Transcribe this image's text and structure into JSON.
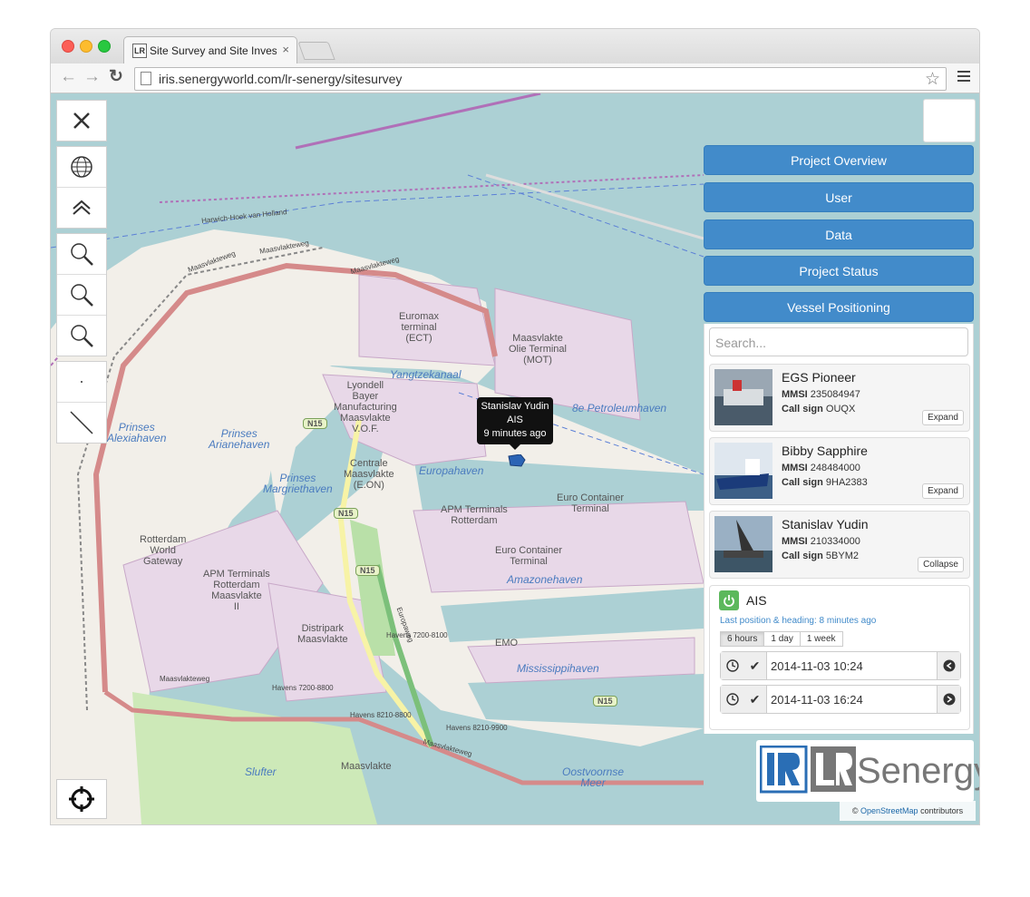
{
  "browser": {
    "tab_title": "Site Survey and Site Invest",
    "tab_close": "×",
    "url": "iris.senergyworld.com/lr-senergy/sitesurvey",
    "favicon_text": "LR"
  },
  "map": {
    "labels": {
      "euromax": "Euromax\nterminal\n(ECT)",
      "maasvlakte_olie": "Maasvlakte\nOlie Terminal\n(MOT)",
      "lyondell": "Lyondell\nBayer\nManufacturing\nMaasvlakte\nV.O.F.",
      "centrale": "Centrale\nMaasvlakte\n(E.ON)",
      "apm_rotterdam": "APM Terminals\nRotterdam",
      "euro_container": "Euro Container\nTerminal",
      "euro_container2": "Euro Container\nTerminal",
      "rotterdam_world_gateway": "Rotterdam\nWorld\nGateway",
      "apm_maasvlakte": "APM Terminals\nRotterdam\nMaasvlakte\nII",
      "distripark": "Distripark\nMaasvlakte",
      "emo": "EMO",
      "maasvlakte": "Maasvlakte",
      "yangtzekanaal": "Yangtzekanaal",
      "petroleumhaven": "8e Petroleumhaven",
      "europahaven": "Europahaven",
      "prinses_alexiahaven": "Prinses\nAlexiahaven",
      "prinses_arianehaven": "Prinses\nArianehaven",
      "prinses_margriethaven": "Prinses\nMargriethaven",
      "amazonehaven": "Amazonehaven",
      "mississippihaven": "Mississippihaven",
      "slufter": "Slufter",
      "oostvoornse_meer": "Oostvoornse\nMeer",
      "maasvlakteweg_a": "Maasvlakteweg",
      "maasvlakteweg_b": "Maasvlakteweg",
      "maasvlakteweg_c": "Maasvlakteweg",
      "maasvlakteweg_d": "Maasvlakteweg",
      "maasvlakteweg_e": "Maasvlakteweg",
      "europaweg": "Europaweg",
      "havens_7200_8100": "Havens 7200-8100",
      "havens_7200_8800": "Havens 7200-8800",
      "havens_8210_8800": "Havens 8210-8800",
      "havens_8210_9900": "Havens 8210-9900",
      "harwich": "Harwich-Hoek van Holland",
      "n15": "N15"
    },
    "tooltip": {
      "name": "Stanislav Yudin",
      "source": "AIS",
      "age": "9 minutes ago"
    }
  },
  "panel": {
    "buttons": [
      "Project Overview",
      "User",
      "Data",
      "Project Status",
      "Vessel Positioning"
    ],
    "search_placeholder": "Search...",
    "vessels": [
      {
        "name": "EGS Pioneer",
        "mmsi_label": "MMSI",
        "mmsi": "235084947",
        "callsign_label": "Call sign",
        "callsign": "OUQX",
        "action": "Expand"
      },
      {
        "name": "Bibby Sapphire",
        "mmsi_label": "MMSI",
        "mmsi": "248484000",
        "callsign_label": "Call sign",
        "callsign": "9HA2383",
        "action": "Expand"
      },
      {
        "name": "Stanislav Yudin",
        "mmsi_label": "MMSI",
        "mmsi": "210334000",
        "callsign_label": "Call sign",
        "callsign": "5BYM2",
        "action": "Collapse"
      }
    ],
    "ais": {
      "title": "AIS",
      "subtitle": "Last position & heading: 8 minutes ago",
      "ranges": [
        "6 hours",
        "1 day",
        "1 week"
      ],
      "active_range": "6 hours",
      "start": "2014-11-03 10:24",
      "end": "2014-11-03 16:24"
    }
  },
  "logo": {
    "brand": "Senergy",
    "mark": "LR"
  },
  "attribution": {
    "prefix": "©",
    "link": "OpenStreetMap",
    "suffix": "contributors"
  },
  "colors": {
    "accent": "#428bca",
    "power_on": "#5cb85c",
    "water": "#acd0d4",
    "industrial": "#e8d8e8",
    "land": "#f2efe9"
  }
}
